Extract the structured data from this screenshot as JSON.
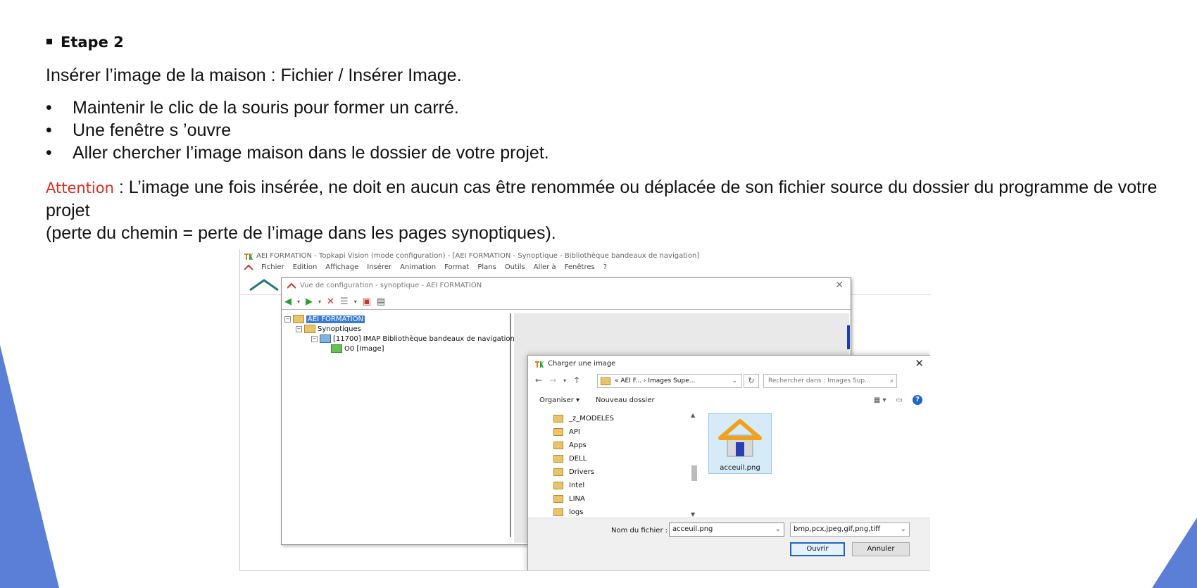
{
  "slide": {
    "step_title": "Etape 2",
    "intro": "Insérer l’image de la maison : Fichier / Insérer Image.",
    "bullets": [
      "Maintenir le clic  de la souris pour former un carré.",
      "Une fenêtre s ’ouvre",
      "Aller chercher l’image maison dans le dossier de votre projet."
    ],
    "attention_label": "Attention",
    "attention_text": " : L’image une fois insérée, ne doit en aucun cas être renommée ou déplacée de son fichier source du dossier du programme de votre projet",
    "attention_text2": "(perte du chemin = perte de l’image dans les pages synoptiques).",
    "colors": {
      "accent_blue": "#5b7fd6",
      "warning": "#e02b20"
    }
  },
  "screenshot": {
    "main_title": "AEI FORMATION - Topkapi Vision (mode configuration) - [AEI FORMATION - Synoptique - Bibliothèque bandeaux de navigation]",
    "menu": [
      "Fichier",
      "Edition",
      "Affichage",
      "Insérer",
      "Animation",
      "Format",
      "Plans",
      "Outils",
      "Aller à",
      "Fenêtres",
      "?"
    ],
    "config_window": {
      "title": "Vue de configuration - synoptique - AEI FORMATION",
      "tree": {
        "root": "AEI FORMATION",
        "synoptiques": "Synoptiques",
        "item": "[11700]  IMAP Bibliothèque bandeaux de navigation",
        "child": "O0 [Image]"
      }
    },
    "dialog": {
      "title": "Charger une image",
      "address": "« AEI F...  ›  Images Supe...",
      "search_placeholder": "Rechercher dans : Images Sup...",
      "organize": "Organiser ▾",
      "new_folder": "Nouveau dossier",
      "folders": [
        "_z_MODELES",
        "API",
        "Apps",
        "DELL",
        "Drivers",
        "Intel",
        "LINA",
        "logs",
        "Nouveau dossier"
      ],
      "file_name": "acceuil.png",
      "filename_label": "Nom du fichier :",
      "filename_value": "acceuil.png",
      "filetype": "bmp,pcx,jpeg,gif,png,tiff",
      "open_button": "Ouvrir",
      "cancel_button": "Annuler"
    }
  }
}
